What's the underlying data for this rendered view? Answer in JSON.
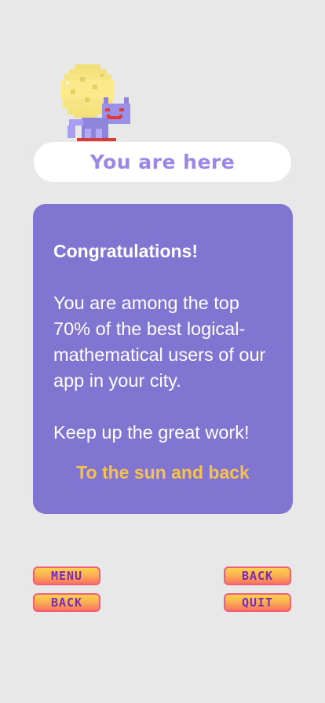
{
  "badge": {
    "label": "You are here",
    "mascot_icon": "pixel-moon-cat-icon"
  },
  "result_card": {
    "heading": "Congratulations!",
    "body": "You are among the top 70% of the best logical-mathematical users of our app in your city.",
    "encouragement": "Keep up the great work!",
    "motto": "To the sun and back"
  },
  "nav": {
    "menu_label": "MENU",
    "back_left_label": "BACK",
    "back_right_label": "BACK",
    "quit_label": "QUIT"
  },
  "colors": {
    "background": "#e8e8e8",
    "card": "#8175d2",
    "badge_text": "#9b87e6",
    "motto": "#f6c24b",
    "button_text": "#7a2bb0"
  }
}
